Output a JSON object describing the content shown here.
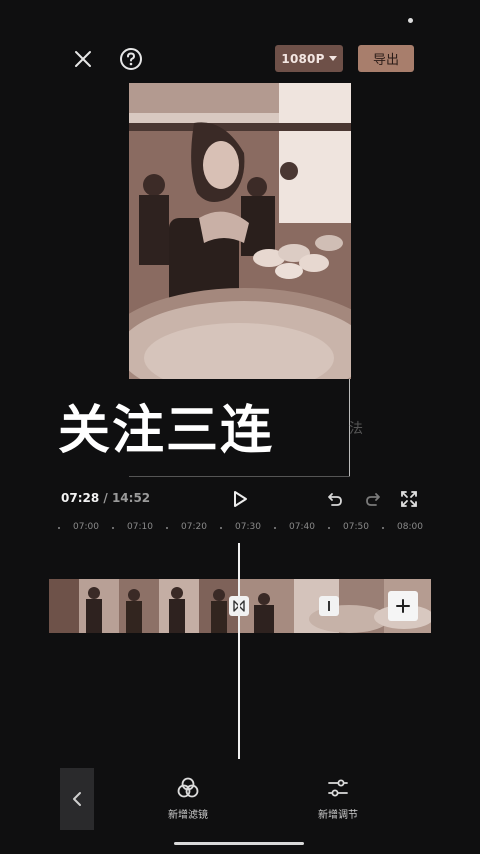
{
  "topbar": {
    "resolution_label": "1080P",
    "export_label": "导出"
  },
  "preview": {
    "overlay_text": "关注三连",
    "side_glyph": "法"
  },
  "playback": {
    "current_time": "07:28",
    "separator": " / ",
    "total_time": "14:52"
  },
  "timeline": {
    "ticks": [
      "07:00",
      "07:10",
      "07:20",
      "07:30",
      "07:40",
      "07:50",
      "08:00"
    ]
  },
  "bottom_toolbar": {
    "items": [
      {
        "label": "新增滤镜",
        "icon": "filter-icon"
      },
      {
        "label": "新增调节",
        "icon": "sliders-icon"
      }
    ]
  },
  "colors": {
    "background": "#0f0f10",
    "resolution_button": "#6e5048",
    "export_button": "#a87e6c",
    "media_tint": "#7a5e55"
  }
}
